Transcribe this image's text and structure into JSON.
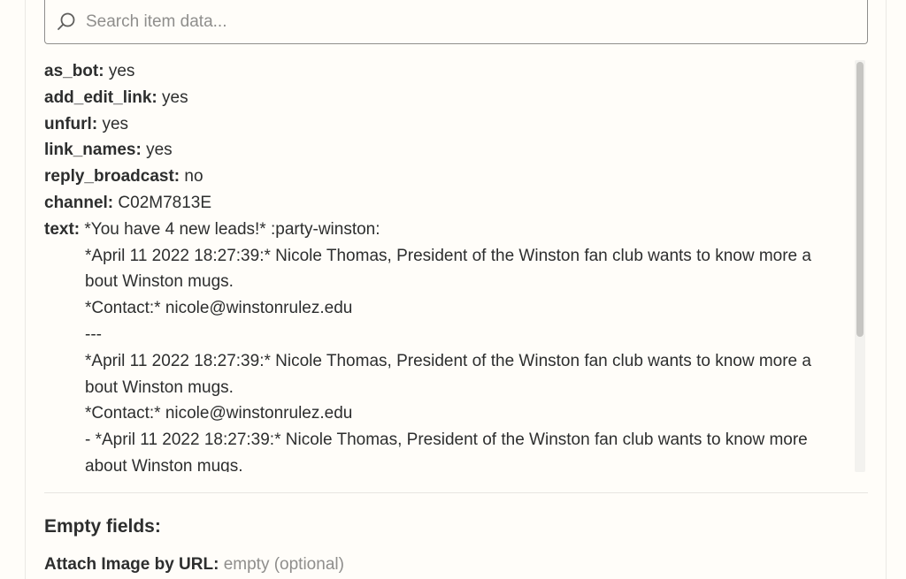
{
  "search": {
    "placeholder": "Search item data..."
  },
  "fields": [
    {
      "key": "as_bot:",
      "value": "yes"
    },
    {
      "key": "add_edit_link:",
      "value": "yes"
    },
    {
      "key": "unfurl:",
      "value": "yes"
    },
    {
      "key": "link_names:",
      "value": "yes"
    },
    {
      "key": "reply_broadcast:",
      "value": "no"
    },
    {
      "key": "channel:",
      "value": "C02M7813E"
    }
  ],
  "text_field": {
    "key": "text:",
    "first_line": "*You have 4 new leads!* :party-winston:",
    "lines": [
      "*April 11 2022 18:27:39:* Nicole Thomas, President of the Winston fan club wants to know more a",
      "bout Winston mugs.",
      "*Contact:* nicole@winstonrulez.edu",
      "---",
      "*April 11 2022 18:27:39:* Nicole Thomas, President of the Winston fan club wants to know more a",
      "bout Winston mugs.",
      "*Contact:* nicole@winstonrulez.edu",
      "- *April 11 2022 18:27:39:* Nicole Thomas, President of the Winston fan club wants to know more",
      "about Winston mugs."
    ]
  },
  "empty_fields": {
    "title": "Empty fields:",
    "items": [
      {
        "key": "Attach Image by URL:",
        "value": "empty (optional)"
      }
    ]
  }
}
